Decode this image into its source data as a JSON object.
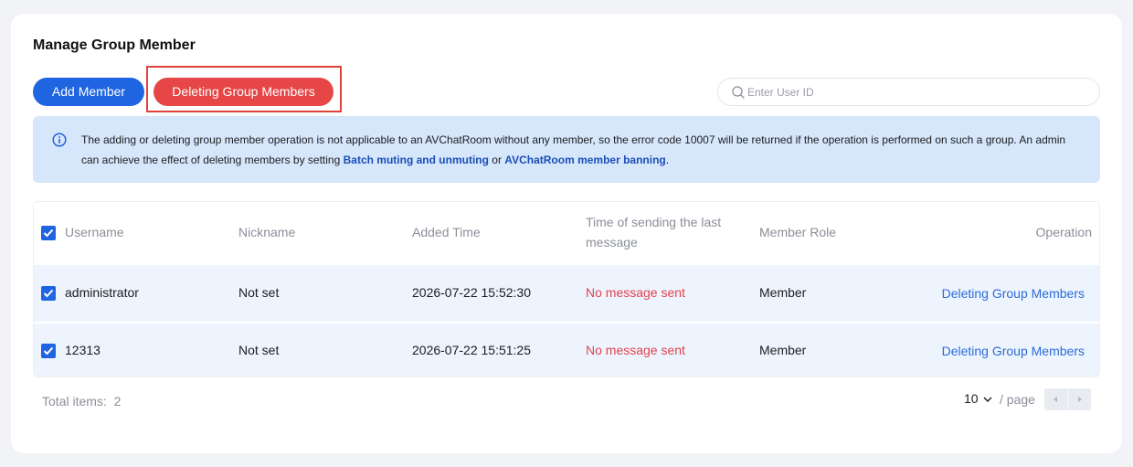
{
  "page": {
    "title": "Manage Group Member"
  },
  "toolbar": {
    "add_label": "Add Member",
    "delete_label": "Deleting Group Members",
    "search_placeholder": "Enter User ID"
  },
  "notice": {
    "text_before": "The adding or deleting group member operation is not applicable to an AVChatRoom without any member, so the error code 10007 will be returned if the operation is performed on such a group. An admin can achieve the effect of deleting members by setting ",
    "link1": "Batch muting and unmuting",
    "text_middle": " or ",
    "link2": "AVChatRoom member banning",
    "text_after": "."
  },
  "table": {
    "headers": {
      "username": "Username",
      "nickname": "Nickname",
      "added_time": "Added Time",
      "last_message_line1": "Time of sending the last",
      "last_message_line2": "message",
      "member_role": "Member Role",
      "operation": "Operation"
    },
    "rows": [
      {
        "username": "administrator",
        "nickname": "Not set",
        "added_time": "2026-07-22 15:52:30",
        "last_message": "No message sent",
        "member_role": "Member",
        "operation": "Deleting Group Members",
        "checked": true
      },
      {
        "username": "12313",
        "nickname": "Not set",
        "added_time": "2026-07-22 15:51:25",
        "last_message": "No message sent",
        "member_role": "Member",
        "operation": "Deleting Group Members",
        "checked": true
      }
    ]
  },
  "footer": {
    "total_label": "Total items:",
    "total_count": "2",
    "page_size": "10",
    "per_page_label": "/ page"
  },
  "colors": {
    "primary": "#1f64e0",
    "danger": "#e64646",
    "highlight_border": "#e0423a",
    "notice_bg": "#d6e6fb",
    "link": "#2a6bd8",
    "no_message": "#e0434f"
  }
}
